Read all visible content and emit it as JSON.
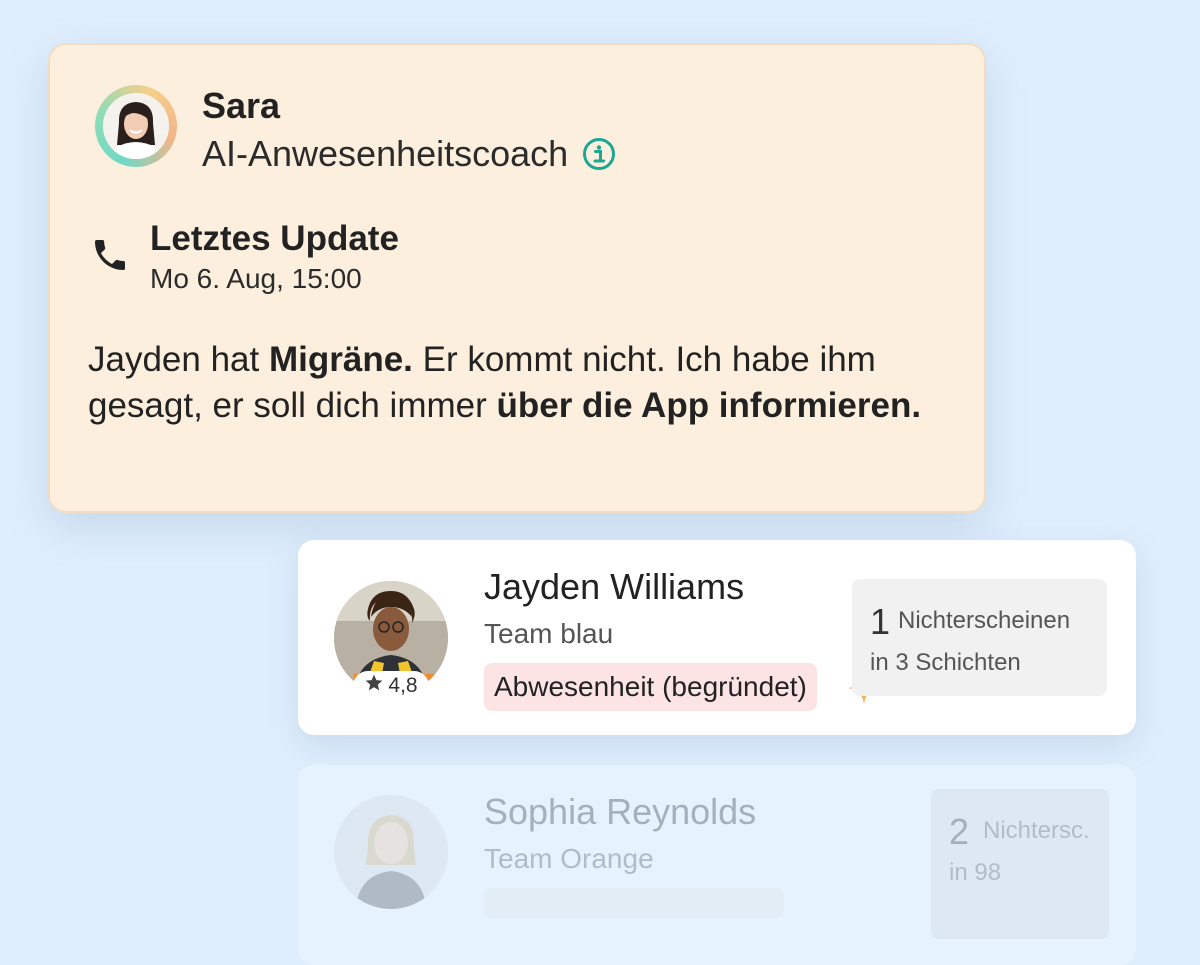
{
  "coach": {
    "name": "Sara",
    "role": "AI-Anwesenheitscoach",
    "update_title": "Letztes Update",
    "update_time": "Mo 6. Aug, 15:00",
    "message": {
      "p1": "Jayden hat ",
      "b1": "Migräne.",
      "p2": " Er kommt nicht. Ich habe ihm gesagt, er soll dich immer ",
      "b2": "über die App informieren."
    }
  },
  "employees": [
    {
      "name": "Jayden Williams",
      "team": "Team blau",
      "rating": "4,8",
      "status": "Abwesenheit (begründet)",
      "stats_count": "1",
      "stats_label": "Nichterscheinen",
      "stats_sub": "in 3 Schichten"
    },
    {
      "name": "Sophia Reynolds",
      "team": "Team Orange",
      "stats_count": "2",
      "stats_label": "Nichtersc.",
      "stats_sub": "in 98"
    }
  ],
  "colors": {
    "accent_teal": "#1aa893",
    "coach_card_bg": "#fdefdd",
    "status_badge_bg": "#fde4e4",
    "sparkle": "#f5b25a"
  },
  "icons": [
    "info-icon",
    "phone-icon",
    "star-icon",
    "sparkle-icon"
  ]
}
